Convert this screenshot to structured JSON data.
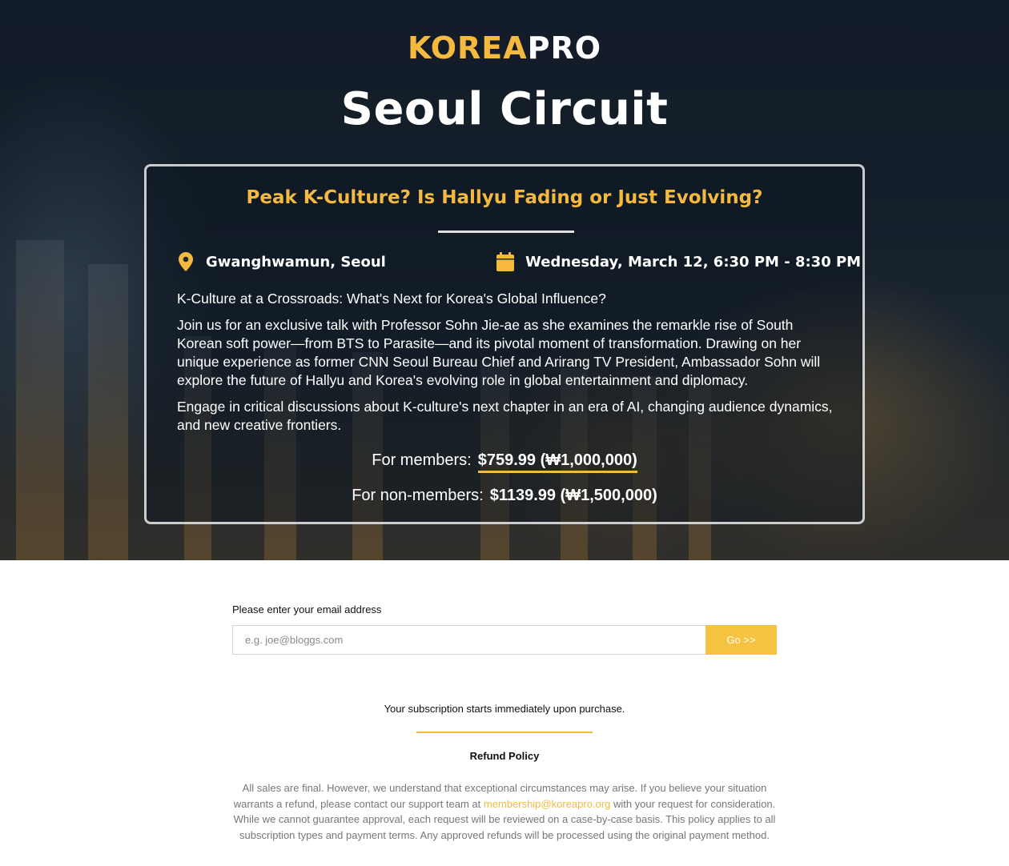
{
  "brand": {
    "logo_part1": "KOREA",
    "logo_part2": "PRO",
    "accent_color": "#f4b93e"
  },
  "hero": {
    "title": "Seoul Circuit"
  },
  "event": {
    "title": "Peak K-Culture? Is Hallyu Fading or Just Evolving?",
    "location_icon": "map-pin-icon",
    "location": "Gwanghwamun, Seoul",
    "date_icon": "calendar-icon",
    "datetime": "Wednesday, March 12, 6:30 PM - 8:30 PM",
    "subtitle": "K-Culture at a Crossroads: What's Next for Korea's Global Influence?",
    "paragraph1": "Join us for an exclusive talk with Professor Sohn Jie-ae as she examines the remarkle rise of South Korean soft power—from BTS to Parasite—and its pivotal moment of transformation. Drawing on her unique experience as former CNN Seoul Bureau Chief and Arirang TV President, Ambassador Sohn will explore the future of Hallyu and Korea's evolving role in global entertainment and diplomacy.",
    "paragraph2": "Engage in critical discussions about K-culture's next chapter in an era of AI, changing audience dynamics, and new creative frontiers."
  },
  "pricing": {
    "members_label": "For members:",
    "members_price": "$759.99 (₩1,000,000)",
    "nonmembers_label": "For non-members:",
    "nonmembers_price": "$1139.99 (₩1,500,000)"
  },
  "form": {
    "email_label": "Please enter your email address",
    "email_placeholder": "e.g. joe@bloggs.com",
    "email_value": "",
    "submit_label": "Go >>"
  },
  "footer": {
    "subscription_note": "Your subscription starts immediately upon purchase.",
    "refund_title": "Refund Policy",
    "refund_text_before": "All sales are final. However, we understand that exceptional circumstances may arise. If you believe your situation warrants a refund, please contact our support team at ",
    "refund_email": "membership@koreapro.org",
    "refund_text_after": " with your request for consideration. While we cannot guarantee approval, each request will be reviewed on a case-by-case basis. This policy applies to all subscription types and payment terms. Any approved refunds will be processed using the original payment method."
  }
}
